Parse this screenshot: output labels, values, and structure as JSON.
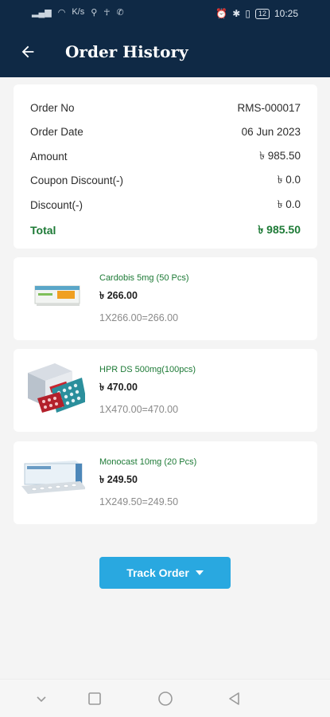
{
  "status_bar": {
    "left_icons": [
      "signal-icon",
      "signal-icon",
      "wifi-icon",
      "speed-icon",
      "usb-icon",
      "person-icon",
      "phone-icon"
    ],
    "speed_text": "K/s",
    "battery": "12",
    "time": "10:25"
  },
  "app_bar": {
    "title": "Order History",
    "back_icon": "arrow-left-icon"
  },
  "summary": {
    "rows": [
      {
        "label": "Order No",
        "value": "RMS-000017"
      },
      {
        "label": "Order Date",
        "value": "06 Jun 2023"
      },
      {
        "label": "Amount",
        "value": "৳ 985.50"
      },
      {
        "label": "Coupon Discount(-)",
        "value": "৳ 0.0"
      },
      {
        "label": "Discount(-)",
        "value": "৳ 0.0"
      }
    ],
    "total_label": "Total",
    "total_value": "৳ 985.50"
  },
  "items": [
    {
      "name": "Cardobis 5mg (50 Pcs)",
      "price": "৳ 266.00",
      "calc": "1X266.00=266.00"
    },
    {
      "name": "HPR DS 500mg(100pcs)",
      "price": "৳ 470.00",
      "calc": "1X470.00=470.00"
    },
    {
      "name": "Monocast 10mg (20 Pcs)",
      "price": "৳ 249.50",
      "calc": "1X249.50=249.50"
    }
  ],
  "track_button": {
    "label": "Track Order",
    "icon": "caret-down-icon"
  },
  "nav_bar": {
    "icons": [
      "chevron-down-icon",
      "square-icon",
      "circle-icon",
      "triangle-back-icon"
    ]
  },
  "colors": {
    "app_bar": "#0f2945",
    "accent_green": "#1d7a36",
    "button_blue": "#29a8e0"
  }
}
